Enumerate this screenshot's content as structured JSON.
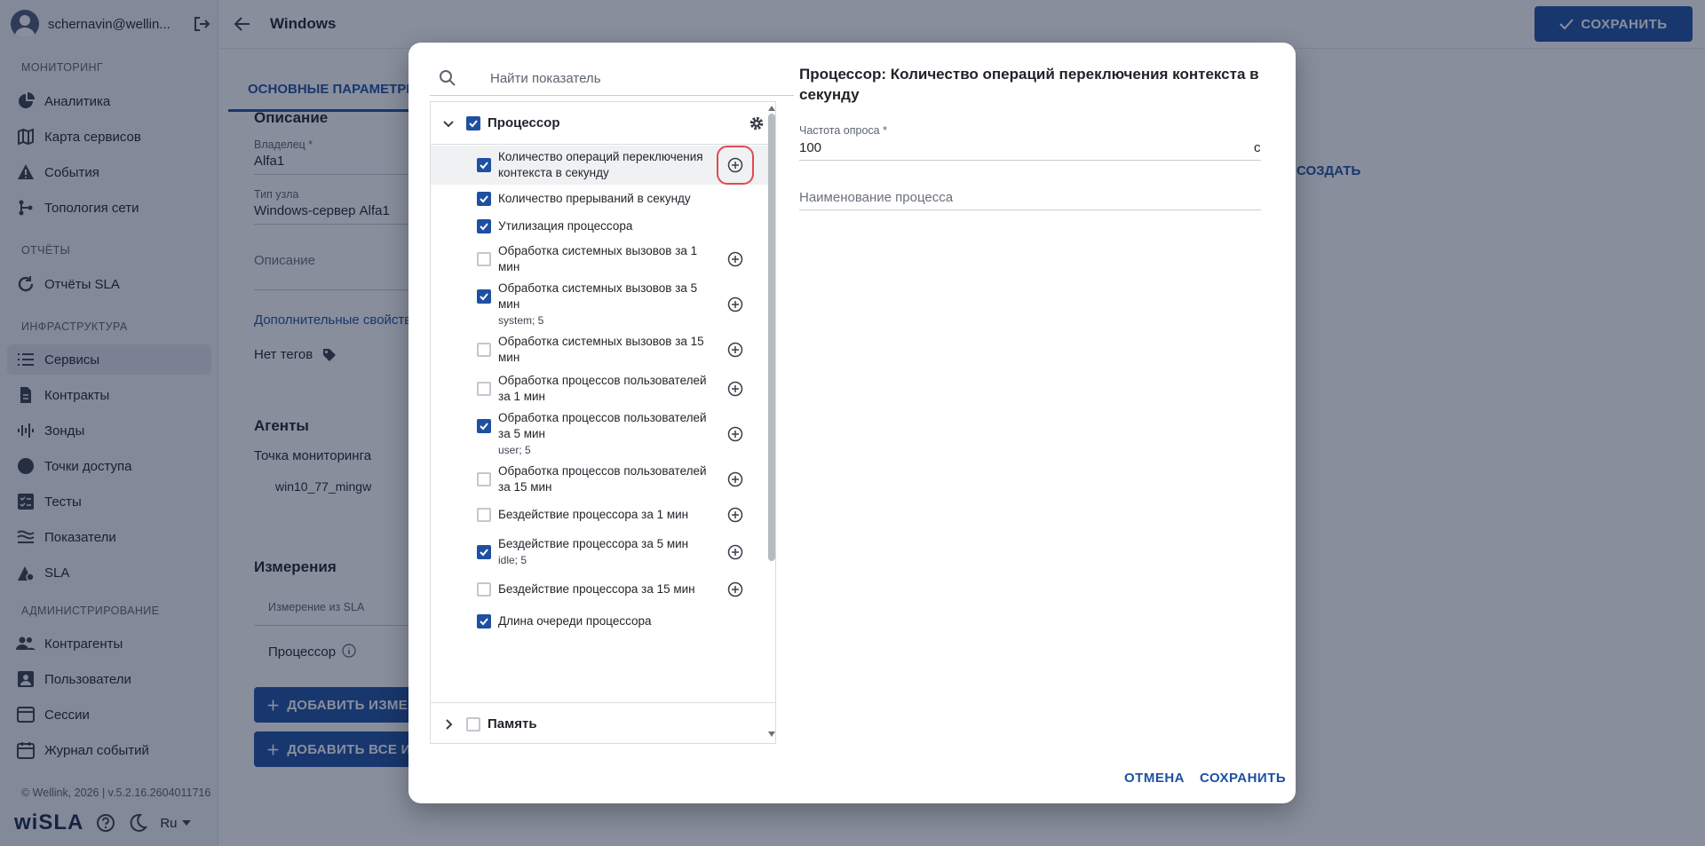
{
  "sidebar": {
    "user": "schernavin@wellin...",
    "sections": {
      "monitoring": "МОНИТОРИНГ",
      "reports": "ОТЧЁТЫ",
      "infra": "ИНФРАСТРУКТУРА",
      "admin": "АДМИНИСТРИРОВАНИЕ"
    },
    "items": {
      "analytics": "Аналитика",
      "service_map": "Карта сервисов",
      "events": "События",
      "topology": "Топология сети",
      "sla_reports": "Отчёты SLA",
      "services": "Сервисы",
      "contracts": "Контракты",
      "probes": "Зонды",
      "access_points": "Точки доступа",
      "tests": "Тесты",
      "indicators": "Показатели",
      "sla": "SLA",
      "contractors": "Контрагенты",
      "users": "Пользователи",
      "sessions": "Сессии",
      "event_log": "Журнал событий"
    },
    "footer": "© Wellink, 2026 | v.5.2.16.2604011716",
    "logo": "wiSLA",
    "lang": "Ru"
  },
  "header": {
    "title": "Windows",
    "save_label": "СОХРАНИТЬ"
  },
  "main": {
    "tab_label": "ОСНОВНЫЕ ПАРАМЕТРЫ",
    "description_title": "Описание",
    "owner_label": "Владелец *",
    "owner_value": "Alfa1",
    "node_type_label": "Тип узла",
    "node_type_value": "Windows-сервер Alfa1",
    "description_placeholder": "Описание",
    "extra_props": "Дополнительные свойства",
    "no_tags": "Нет тегов",
    "agents_title": "Агенты",
    "monitoring_point": "Точка мониторинга",
    "agent_name": "win10_77_mingw",
    "create_link": "СОЗДАТЬ",
    "measurements_title": "Измерения",
    "measurement_header": "Измерение из SLA",
    "measurement_row": "Процессор",
    "add_measurement_btn": "ДОБАВИТЬ ИЗМЕРЕНИЕ",
    "add_all_btn": "ДОБАВИТЬ ВСЕ ИЗМЕРЕНИЯ"
  },
  "modal": {
    "search_placeholder": "Найти показатель",
    "groups": {
      "cpu": "Процессор",
      "memory": "Память"
    },
    "items": [
      {
        "text": "Количество операций переключения контекста в секунду",
        "sub": "",
        "checked": true
      },
      {
        "text": "Количество прерываний в секунду",
        "sub": "",
        "checked": true
      },
      {
        "text": "Утилизация процессора",
        "sub": "",
        "checked": true
      },
      {
        "text": "Обработка системных вызовов за 1 мин",
        "sub": "",
        "checked": false
      },
      {
        "text": "Обработка системных вызовов за 5 мин",
        "sub": "system; 5",
        "checked": true
      },
      {
        "text": "Обработка системных вызовов за 15 мин",
        "sub": "",
        "checked": false
      },
      {
        "text": "Обработка процессов пользователей за 1 мин",
        "sub": "",
        "checked": false
      },
      {
        "text": "Обработка процессов пользователей за 5 мин",
        "sub": "user; 5",
        "checked": true
      },
      {
        "text": "Обработка процессов пользователей за 15 мин",
        "sub": "",
        "checked": false
      },
      {
        "text": "Бездействие процессора за 1 мин",
        "sub": "",
        "checked": false
      },
      {
        "text": "Бездействие процессора за 5 мин",
        "sub": "idle; 5",
        "checked": true
      },
      {
        "text": "Бездействие процессора за 15 мин",
        "sub": "",
        "checked": false
      },
      {
        "text": "Длина очереди процессора",
        "sub": "",
        "checked": true
      }
    ],
    "detail": {
      "title": "Процессор: Количество операций переключения контекста в секунду",
      "poll_label": "Частота опроса *",
      "poll_value": "100",
      "poll_unit": "с",
      "process_placeholder": "Наименование процесса"
    },
    "cancel_label": "ОТМЕНА",
    "save_label": "СОХРАНИТЬ"
  }
}
